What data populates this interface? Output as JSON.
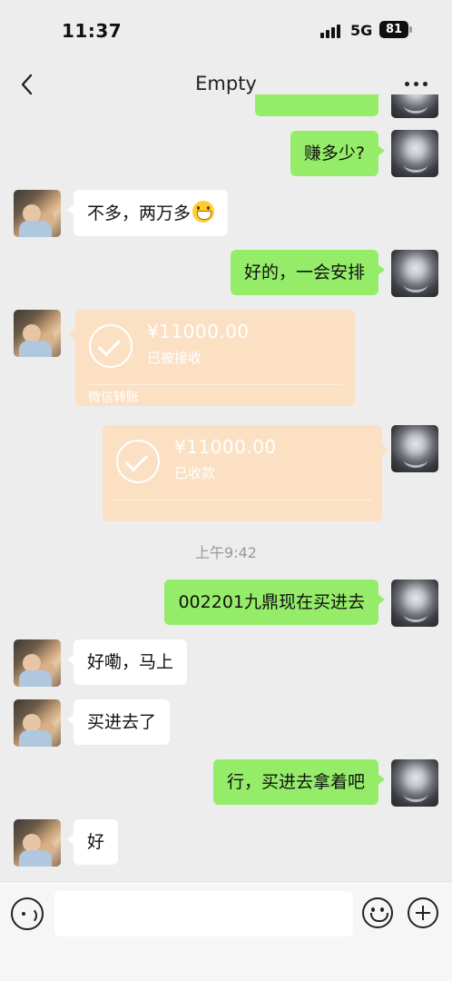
{
  "status_bar": {
    "time": "11:37",
    "network": "5G",
    "battery": "81"
  },
  "nav": {
    "title": "Empty"
  },
  "timestamp": "上午9:42",
  "messages": {
    "m1": "赚多少?",
    "m2": "不多，两万多",
    "m3": "好的，一会安排",
    "m4": "002201九鼎现在买进去",
    "m5": "好嘞，马上",
    "m6": "买进去了",
    "m7": "行，买进去拿着吧",
    "m8": "好"
  },
  "transfers": {
    "t1": {
      "amount": "¥11000.00",
      "status": "已被接收",
      "footer": "微信转账"
    },
    "t2": {
      "amount": "¥11000.00",
      "status": "已收款",
      "footer": ""
    }
  },
  "icons": {
    "back": "chevron-left-icon",
    "more": "more-dots-icon",
    "voice": "voice-icon",
    "emoji": "smile-icon",
    "plus": "plus-icon"
  },
  "colors": {
    "background": "#ededed",
    "sent_bubble": "#95ec69",
    "received_bubble": "#ffffff",
    "transfer_card": "#fbe0c4"
  }
}
